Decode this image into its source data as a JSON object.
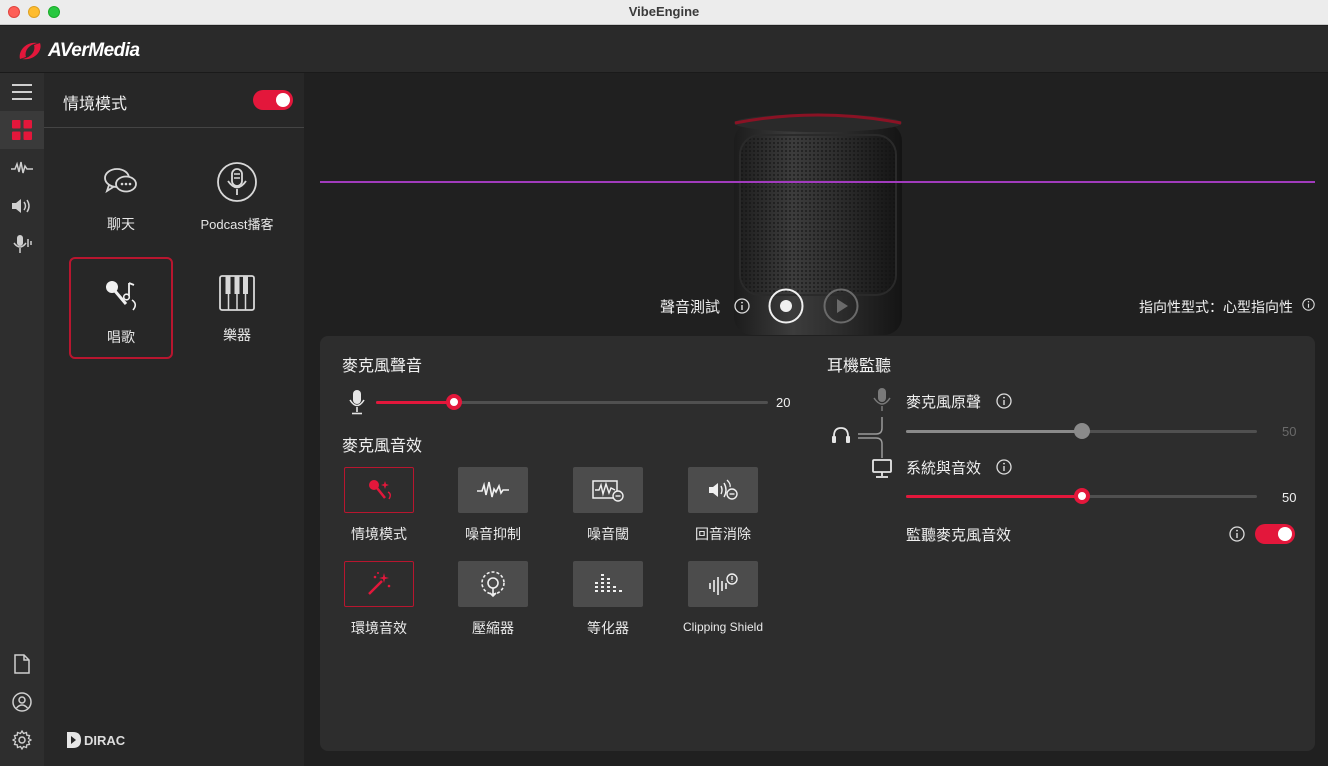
{
  "window": {
    "title": "VibeEngine"
  },
  "brand": {
    "name": "AVerMedia"
  },
  "scene_panel": {
    "title": "情境模式",
    "enabled": true,
    "modes": [
      {
        "label": "聊天",
        "icon": "chat-bubbles-icon",
        "selected": false
      },
      {
        "label": "Podcast播客",
        "icon": "podcast-mic-icon",
        "selected": false
      },
      {
        "label": "唱歌",
        "icon": "singing-mic-icon",
        "selected": true
      },
      {
        "label": "樂器",
        "icon": "piano-keys-icon",
        "selected": false
      }
    ],
    "footer_brand": "DIRAC"
  },
  "main": {
    "sound_test_label": "聲音測試",
    "polar_pattern_label": "指向性型式：心型指向性"
  },
  "mic_volume": {
    "title": "麥克風聲音",
    "value": 20,
    "value_text": "20",
    "max": 100
  },
  "mic_effects": {
    "title": "麥克風音效",
    "items": [
      {
        "label": "情境模式",
        "icon": "mic-sparkle-icon",
        "active": true
      },
      {
        "label": "噪音抑制",
        "icon": "noise-wave-icon",
        "active": false
      },
      {
        "label": "噪音閾",
        "icon": "noise-gate-icon",
        "active": false
      },
      {
        "label": "回音消除",
        "icon": "echo-cancel-icon",
        "active": false
      },
      {
        "label": "環境音效",
        "icon": "magic-wand-icon",
        "active": true
      },
      {
        "label": "壓縮器",
        "icon": "compressor-dial-icon",
        "active": false
      },
      {
        "label": "等化器",
        "icon": "equalizer-icon",
        "active": false
      },
      {
        "label": "Clipping Shield",
        "icon": "clipping-shield-icon",
        "active": false
      }
    ]
  },
  "monitoring": {
    "title": "耳機監聽",
    "mic_raw": {
      "label": "麥克風原聲",
      "value": 50,
      "value_text": "50",
      "enabled": false
    },
    "system": {
      "label": "系統與音效",
      "value": 50,
      "value_text": "50",
      "enabled": true
    },
    "monitor_fx": {
      "label": "監聽麥克風音效",
      "enabled": true
    }
  },
  "colors": {
    "accent": "#e3173b",
    "accent_dark": "#b8162f",
    "waveform": "#a13bbd"
  }
}
